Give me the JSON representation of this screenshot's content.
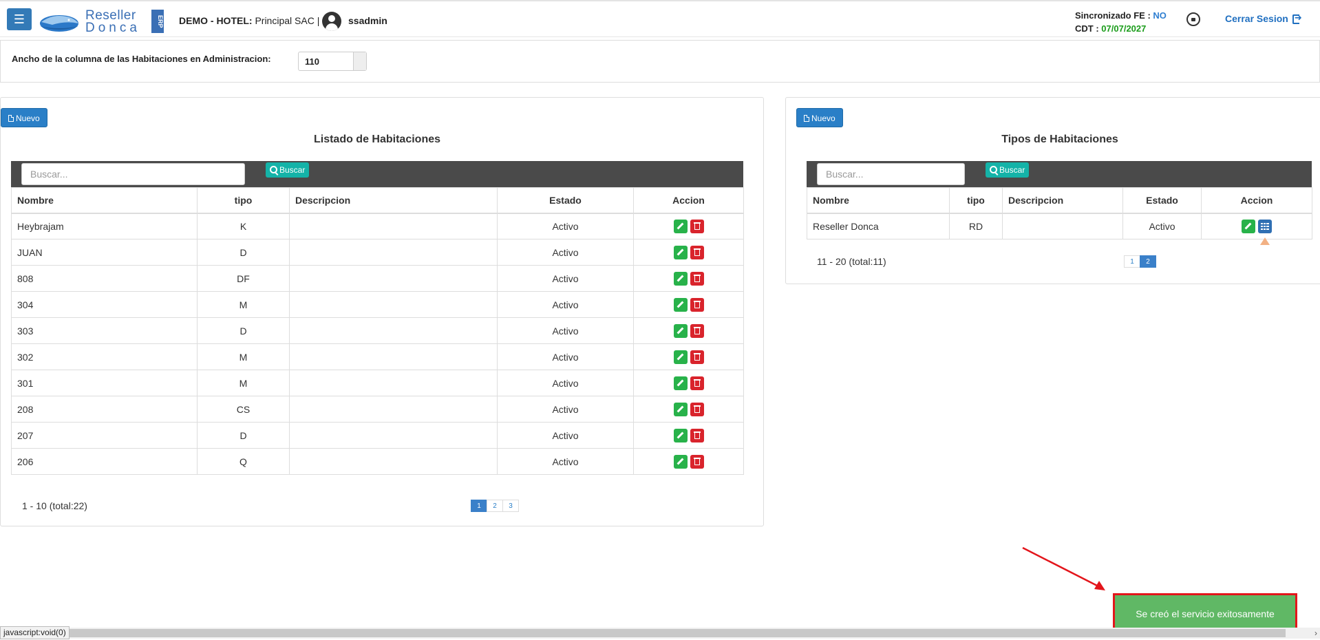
{
  "header": {
    "logo_line1": "Reseller",
    "logo_line2": "Donca",
    "logo_badge": "ERP",
    "company_label": "DEMO - HOTEL:",
    "company_name": "Principal SAC |",
    "username": "ssadmin",
    "sync_label": "Sincronizado FE :",
    "sync_value": "NO",
    "cdt_label": "CDT :",
    "cdt_value": "07/07/2027",
    "logout_label": "Cerrar Sesion"
  },
  "setting": {
    "label": "Ancho de la columna de las Habitaciones en Administracion:",
    "value": "110"
  },
  "rooms": {
    "new_label": "Nuevo",
    "title": "Listado de Habitaciones",
    "search_placeholder": "Buscar...",
    "search_button": "Buscar",
    "columns": [
      "Nombre",
      "tipo",
      "Descripcion",
      "Estado",
      "Accion"
    ],
    "rows": [
      {
        "nombre": "Heybrajam",
        "tipo": "K",
        "descripcion": "",
        "estado": "Activo"
      },
      {
        "nombre": "JUAN",
        "tipo": "D",
        "descripcion": "",
        "estado": "Activo"
      },
      {
        "nombre": "808",
        "tipo": "DF",
        "descripcion": "",
        "estado": "Activo"
      },
      {
        "nombre": "304",
        "tipo": "M",
        "descripcion": "",
        "estado": "Activo"
      },
      {
        "nombre": "303",
        "tipo": "D",
        "descripcion": "",
        "estado": "Activo"
      },
      {
        "nombre": "302",
        "tipo": "M",
        "descripcion": "",
        "estado": "Activo"
      },
      {
        "nombre": "301",
        "tipo": "M",
        "descripcion": "",
        "estado": "Activo"
      },
      {
        "nombre": "208",
        "tipo": "CS",
        "descripcion": "",
        "estado": "Activo"
      },
      {
        "nombre": "207",
        "tipo": "D",
        "descripcion": "",
        "estado": "Activo"
      },
      {
        "nombre": "206",
        "tipo": "Q",
        "descripcion": "",
        "estado": "Activo"
      }
    ],
    "pager_info": "1 - 10 (total:22)",
    "pages": [
      "1",
      "2",
      "3"
    ],
    "active_page": "1"
  },
  "types": {
    "new_label": "Nuevo",
    "title": "Tipos de Habitaciones",
    "search_placeholder": "Buscar...",
    "search_button": "Buscar",
    "columns": [
      "Nombre",
      "tipo",
      "Descripcion",
      "Estado",
      "Accion"
    ],
    "rows": [
      {
        "nombre": "Reseller Donca",
        "tipo": "RD",
        "descripcion": "",
        "estado": "Activo"
      }
    ],
    "pager_info": "11 - 20 (total:11)",
    "pages": [
      "1",
      "2"
    ],
    "active_page": "2"
  },
  "toast": {
    "message": "Se creó el servicio exitosamente"
  },
  "statusbar": {
    "text": "javascript:void(0)"
  },
  "colors": {
    "primary": "#337ab7",
    "success_toast": "#60b865",
    "annotation_red": "#e3151b",
    "edit_green": "#28b24a",
    "delete_red": "#d9242c"
  }
}
